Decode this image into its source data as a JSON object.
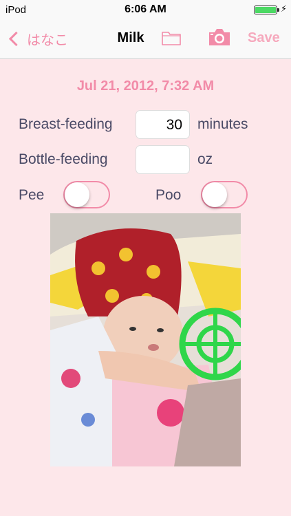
{
  "status_bar": {
    "carrier": "iPod",
    "time": "6:06 AM",
    "charging_symbol": "⚡"
  },
  "nav": {
    "back_label": "はなこ",
    "title": "Milk",
    "save_label": "Save",
    "icons": [
      "folder-icon",
      "camera-icon"
    ]
  },
  "entry": {
    "date": "Jul 21, 2012, 7:32 AM",
    "breast_feeding": {
      "label": "Breast-feeding",
      "value": "30",
      "unit": "minutes"
    },
    "bottle_feeding": {
      "label": "Bottle-feeding",
      "value": "",
      "unit": "oz"
    },
    "pee": {
      "label": "Pee",
      "on": false
    },
    "poo": {
      "label": "Poo",
      "on": false
    }
  },
  "colors": {
    "accent": "#f28ba8",
    "save_disabled": "#f6a9bd",
    "background": "#fde7ea",
    "label": "#4a4a66"
  }
}
